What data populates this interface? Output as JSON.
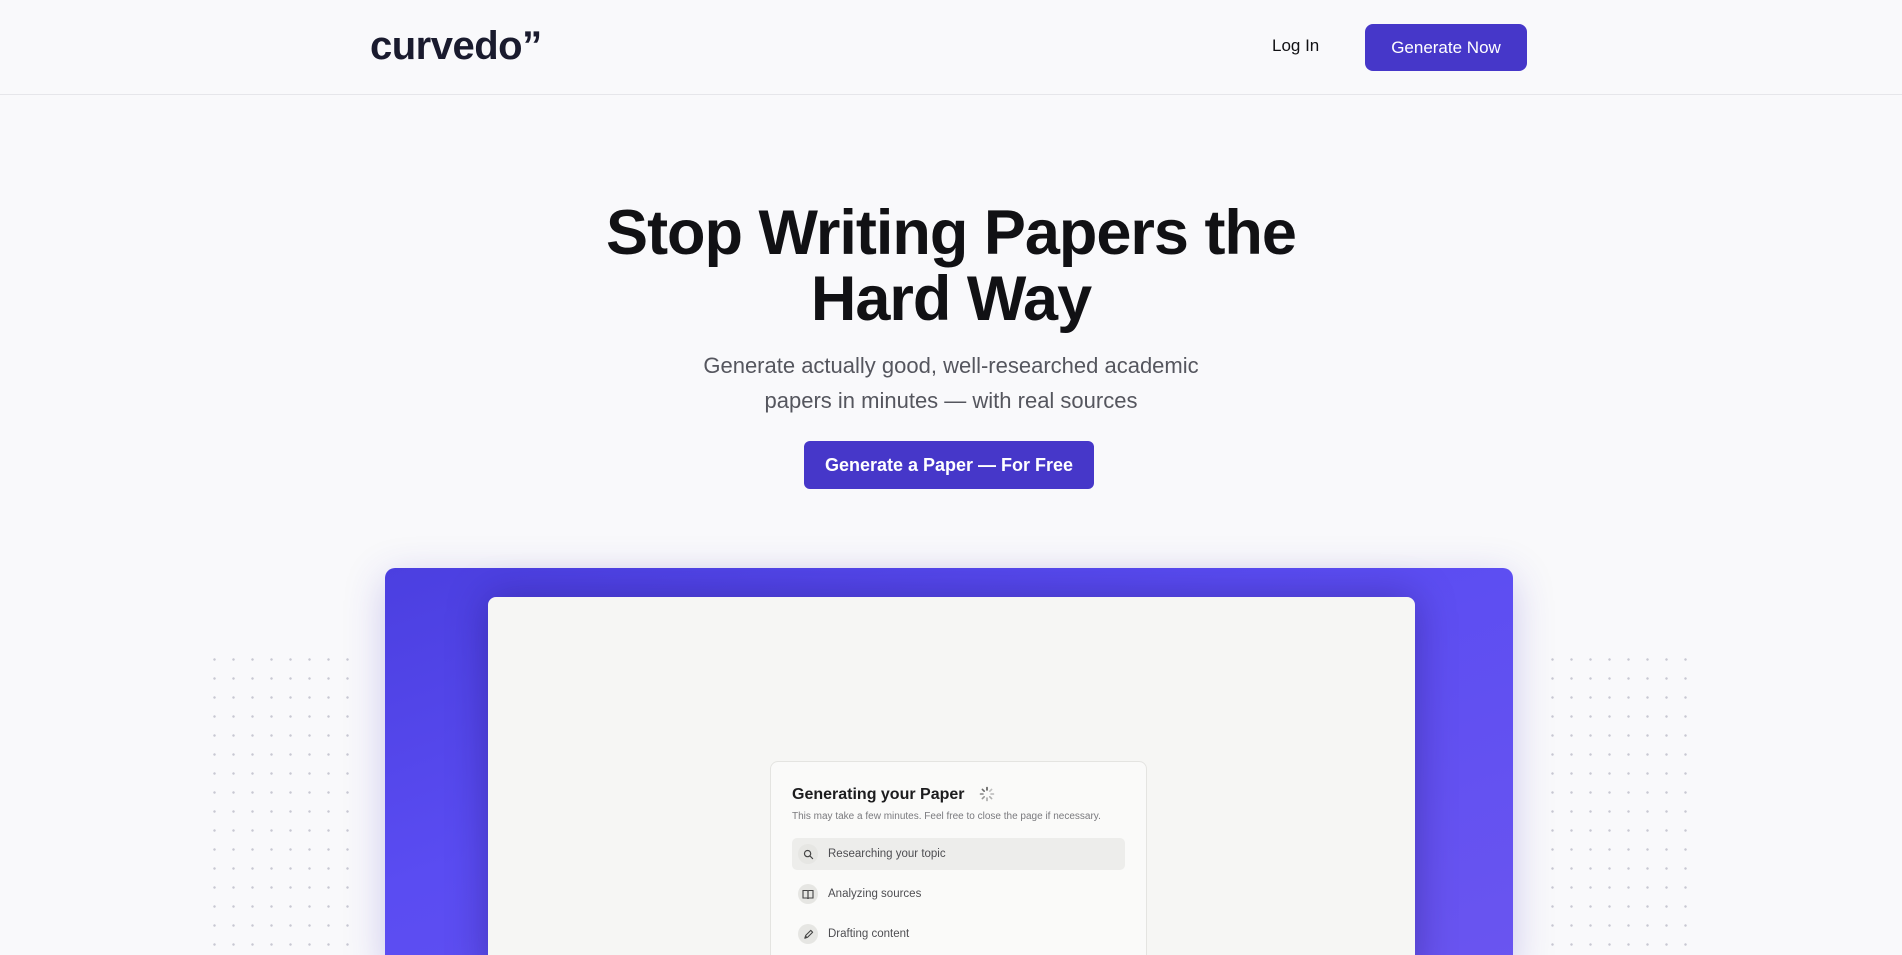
{
  "header": {
    "logo": "curvedo”",
    "login_label": "Log In",
    "generate_now_label": "Generate Now"
  },
  "hero": {
    "title_line1": "Stop Writing Papers the",
    "title_line2": "Hard Way",
    "subtitle_line1": "Generate actually good, well-researched academic",
    "subtitle_line2": "papers in minutes — with real sources",
    "cta_label": "Generate a Paper — For Free"
  },
  "preview": {
    "card_title": "Generating your Paper",
    "card_note": "This may take a few minutes. Feel free to close the page if necessary.",
    "steps": [
      {
        "label": "Researching your topic",
        "icon": "search-icon",
        "active": true
      },
      {
        "label": "Analyzing sources",
        "icon": "book-icon",
        "active": false
      },
      {
        "label": "Drafting content",
        "icon": "pen-icon",
        "active": false
      }
    ]
  },
  "colors": {
    "accent": "#4637c9",
    "frame_gradient_start": "#4b3fe0",
    "frame_gradient_end": "#6a55f0",
    "text_dark": "#111114",
    "text_muted": "#55565e"
  }
}
